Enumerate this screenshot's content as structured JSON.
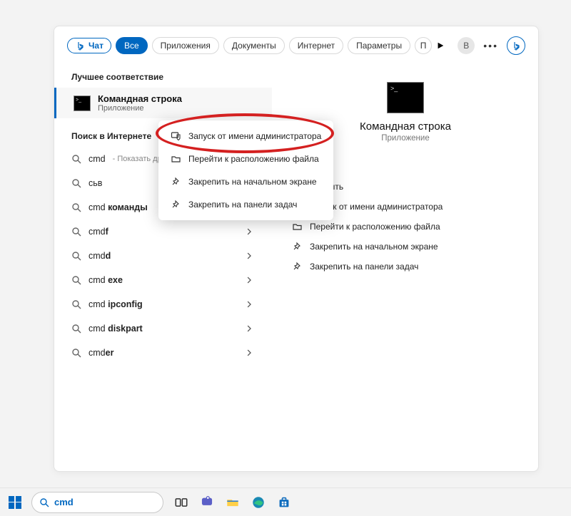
{
  "tabs": {
    "chat": "Чат",
    "all": "Все",
    "apps": "Приложения",
    "docs": "Документы",
    "internet": "Интернет",
    "settings": "Параметры",
    "more_initial": "П"
  },
  "user_initial": "B",
  "left": {
    "best_label": "Лучшее соответствие",
    "best_match": {
      "title": "Командная строка",
      "subtitle": "Приложение"
    },
    "internet_label": "Поиск в Интернете",
    "items": [
      {
        "prefix": "cmd",
        "hint": " - Показать другие результаты поиска",
        "bold": "",
        "has_chevron": false
      },
      {
        "prefix": "сьв",
        "hint": "",
        "bold": "",
        "has_chevron": true
      },
      {
        "prefix": "cmd ",
        "bold": "команды",
        "hint": "",
        "has_chevron": true
      },
      {
        "prefix": "cmd",
        "bold": "f",
        "hint": "",
        "has_chevron": true
      },
      {
        "prefix": "cmd",
        "bold": "d",
        "hint": "",
        "has_chevron": true
      },
      {
        "prefix": "cmd ",
        "bold": "exe",
        "hint": "",
        "has_chevron": true
      },
      {
        "prefix": "cmd ",
        "bold": "ipconfig",
        "hint": "",
        "has_chevron": true
      },
      {
        "prefix": "cmd ",
        "bold": "diskpart",
        "hint": "",
        "has_chevron": true
      },
      {
        "prefix": "cmd",
        "bold": "er",
        "hint": "",
        "has_chevron": true
      }
    ]
  },
  "right": {
    "title": "Командная строка",
    "subtitle": "Приложение",
    "actions": [
      {
        "icon": "open",
        "label": "Открыть"
      },
      {
        "icon": "shield",
        "label": "Запуск от имени администратора"
      },
      {
        "icon": "folder",
        "label": "Перейти к расположению файла"
      },
      {
        "icon": "pin-start",
        "label": "Закрепить на начальном экране"
      },
      {
        "icon": "pin-task",
        "label": "Закрепить на панели задач"
      }
    ]
  },
  "context_menu": [
    {
      "icon": "shield",
      "label": "Запуск от имени администратора"
    },
    {
      "icon": "folder",
      "label": "Перейти к расположению файла"
    },
    {
      "icon": "pin-start",
      "label": "Закрепить на начальном экране"
    },
    {
      "icon": "pin-task",
      "label": "Закрепить на панели задач"
    }
  ],
  "taskbar": {
    "search_value": "cmd"
  }
}
